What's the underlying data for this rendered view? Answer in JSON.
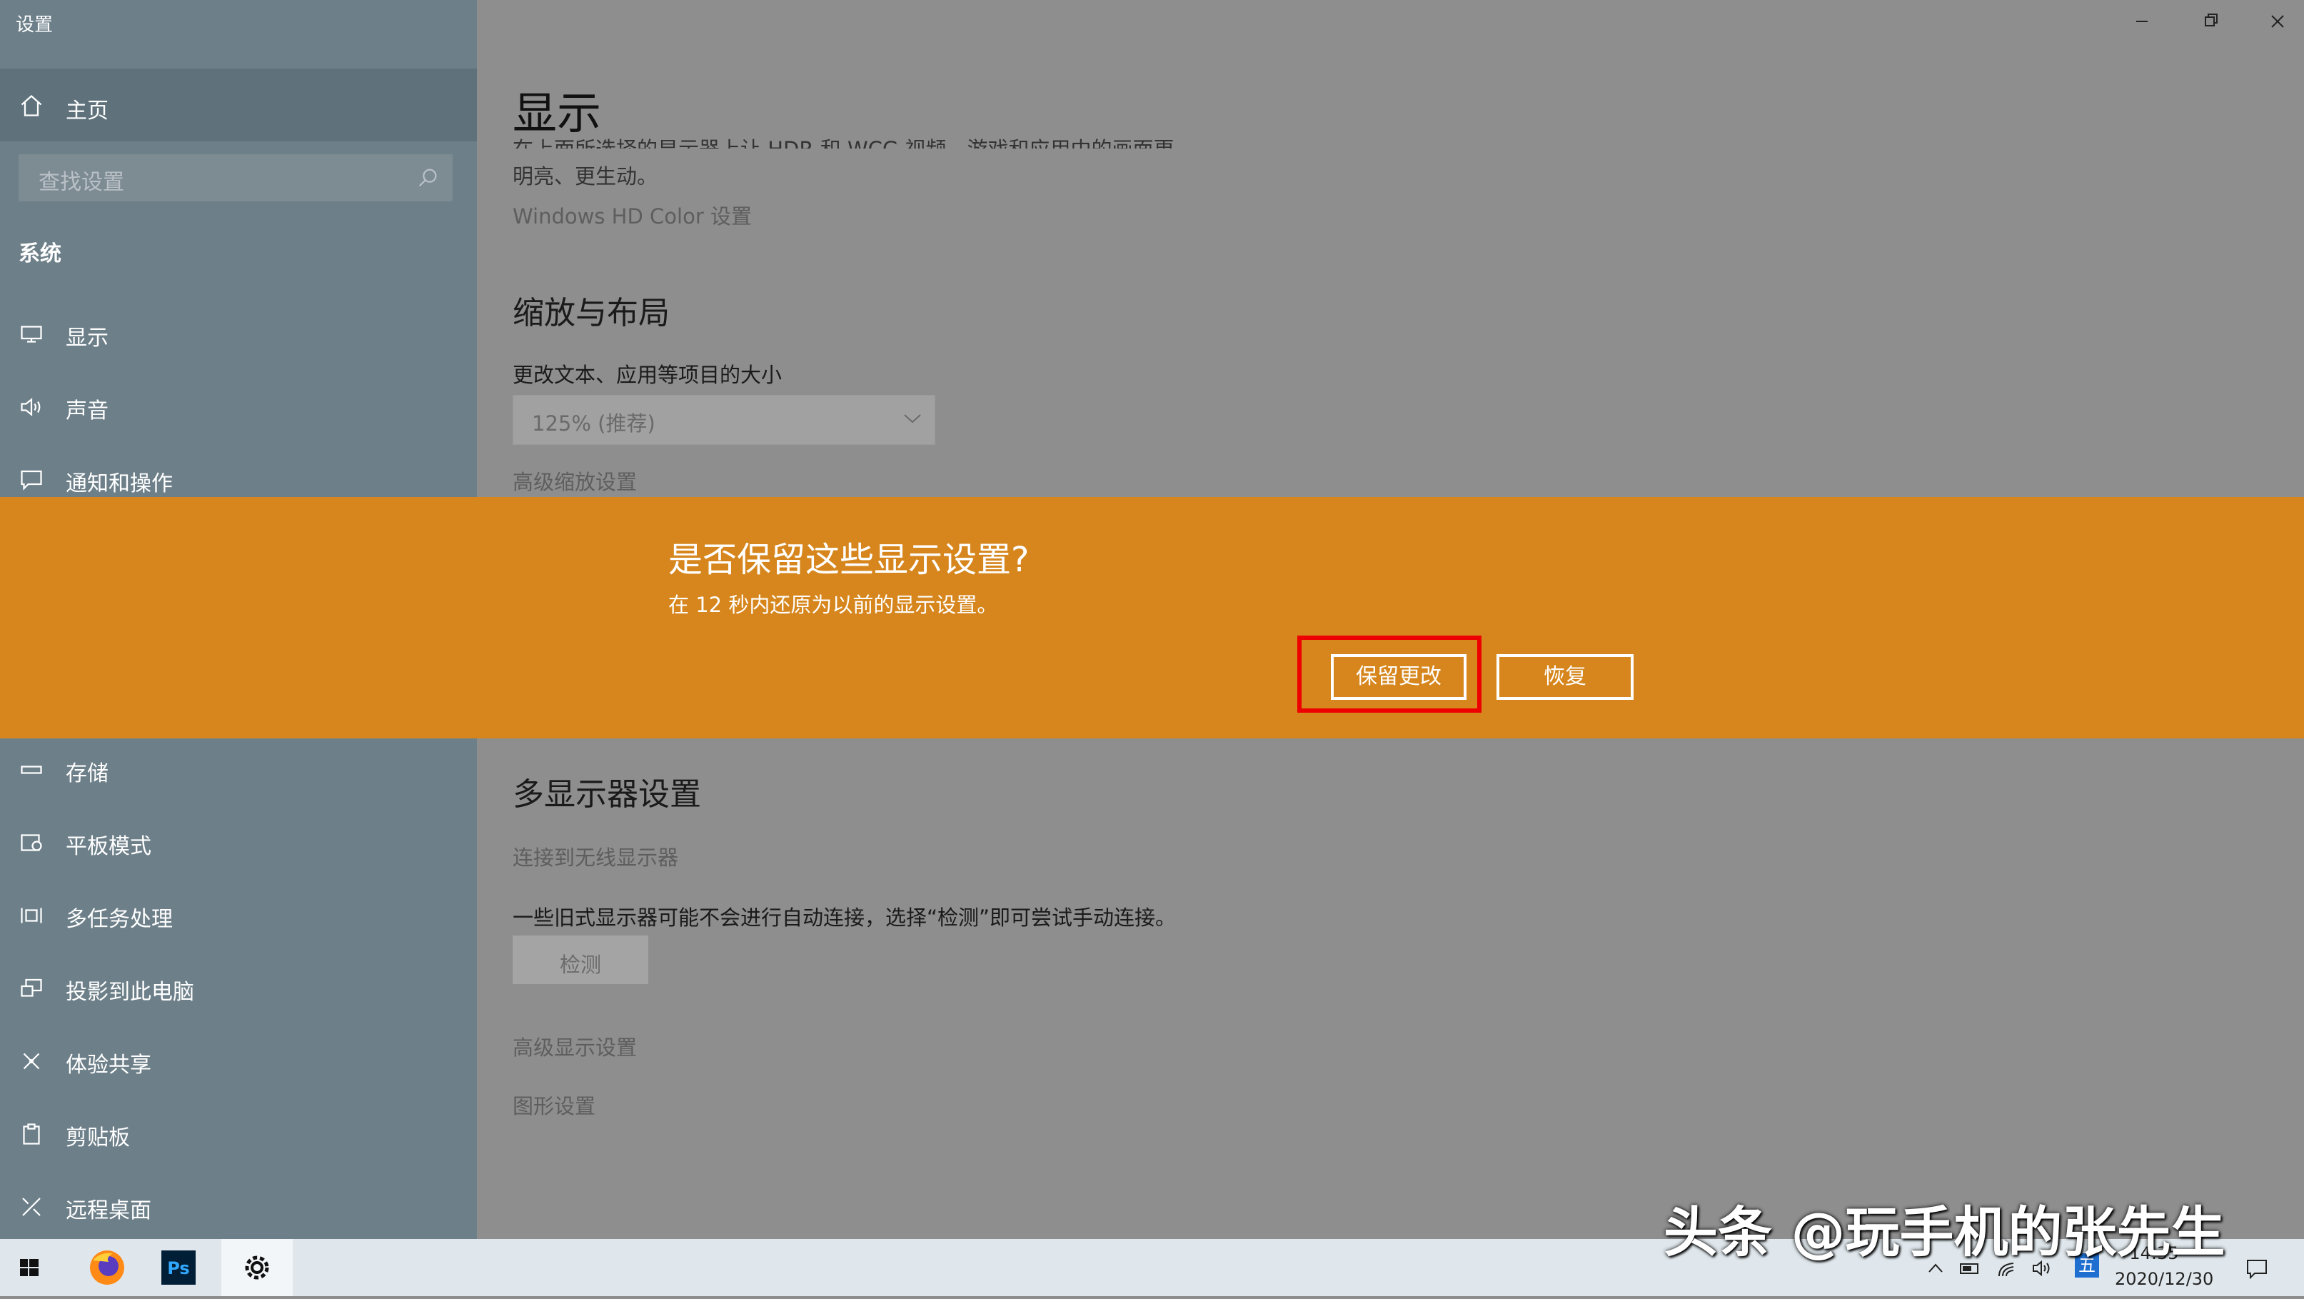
{
  "window": {
    "title": "设置"
  },
  "sidebar": {
    "home_label": "主页",
    "search_placeholder": "查找设置",
    "section_title": "系统",
    "items_top": [
      {
        "label": "显示",
        "icon": "monitor-icon"
      },
      {
        "label": "声音",
        "icon": "speaker-icon"
      },
      {
        "label": "通知和操作",
        "icon": "notification-icon"
      }
    ],
    "items_bottom": [
      {
        "label": "存储",
        "icon": "storage-icon"
      },
      {
        "label": "平板模式",
        "icon": "tablet-mode-icon"
      },
      {
        "label": "多任务处理",
        "icon": "multitasking-icon"
      },
      {
        "label": "投影到此电脑",
        "icon": "projecting-icon"
      },
      {
        "label": "体验共享",
        "icon": "shared-experiences-icon"
      },
      {
        "label": "剪贴板",
        "icon": "clipboard-icon"
      },
      {
        "label": "远程桌面",
        "icon": "remote-desktop-icon"
      }
    ]
  },
  "main": {
    "page_title": "显示",
    "hdr_text_line1": "在上面所选择的显示器上让 HDR 和 WCG 视频、游戏和应用中的画面更",
    "hdr_text_line2": "明亮、更生动。",
    "hdr_link": "Windows HD Color 设置",
    "scale_heading": "缩放与布局",
    "scale_label": "更改文本、应用等项目的大小",
    "scale_value": "125% (推荐)",
    "advanced_scaling_link": "高级缩放设置",
    "multi_heading": "多显示器设置",
    "wireless_link": "连接到无线显示器",
    "detect_text": "一些旧式显示器可能不会进行自动连接，选择“检测”即可尝试手动连接。",
    "detect_button": "检测",
    "advanced_display_link": "高级显示设置",
    "graphics_link": "图形设置"
  },
  "dialog": {
    "title": "是否保留这些显示设置?",
    "message": "在 12 秒内还原为以前的显示设置。",
    "keep_button": "保留更改",
    "revert_button": "恢复"
  },
  "taskbar": {
    "time": "14:35",
    "date": "2020/12/30",
    "ime": "五"
  },
  "watermark": "头条 @玩手机的张先生",
  "colors": {
    "banner": "#d6861c",
    "highlight": "#ee0000",
    "sidebar": "#6d7f89"
  }
}
